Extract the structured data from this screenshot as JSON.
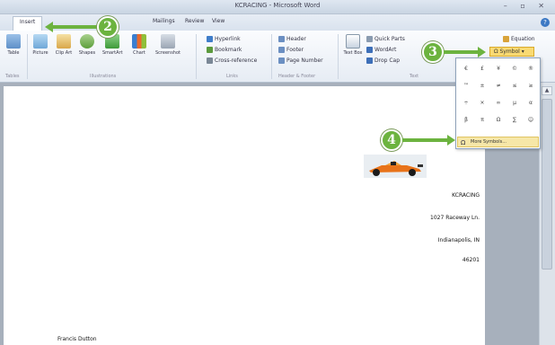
{
  "window": {
    "title": "KCRACING - Microsoft Word"
  },
  "tabs": [
    {
      "label": "Insert"
    },
    {
      "label": "Mailings"
    },
    {
      "label": "Review"
    },
    {
      "label": "View"
    }
  ],
  "ribbon": {
    "tables": {
      "table_label": "Table",
      "group": "Tables"
    },
    "illustrations": {
      "picture": "Picture",
      "clipart": "Clip Art",
      "shapes": "Shapes",
      "smartart": "SmartArt",
      "chart": "Chart",
      "screenshot": "Screenshot",
      "group": "Illustrations"
    },
    "links": {
      "hyperlink": "Hyperlink",
      "bookmark": "Bookmark",
      "crossref": "Cross-reference",
      "group": "Links"
    },
    "header_footer": {
      "header": "Header",
      "footer": "Footer",
      "page_number": "Page Number",
      "group": "Header & Footer"
    },
    "text": {
      "textbox": "Text Box",
      "quickparts": "Quick Parts",
      "wordart": "WordArt",
      "dropcap": "Drop Cap",
      "group": "Text"
    },
    "symbols": {
      "equation": "Equation",
      "symbol": "Symbol"
    }
  },
  "symbol_panel": {
    "symbols": [
      "€",
      "£",
      "¥",
      "©",
      "®",
      "™",
      "±",
      "≠",
      "≤",
      "≥",
      "÷",
      "×",
      "∞",
      "µ",
      "α",
      "β",
      "π",
      "Ω",
      "∑",
      "☺"
    ],
    "more_symbols": "More Symbols..."
  },
  "document": {
    "address": [
      "KCRACING",
      "1027 Raceway Ln.",
      "Indianapolis, IN",
      "46201"
    ],
    "signature": "Francis Dutton"
  },
  "callouts": {
    "two": "2",
    "three": "3",
    "four": "4"
  },
  "colors": {
    "callout": "#6cb33f",
    "highlight": "#f9da73"
  }
}
